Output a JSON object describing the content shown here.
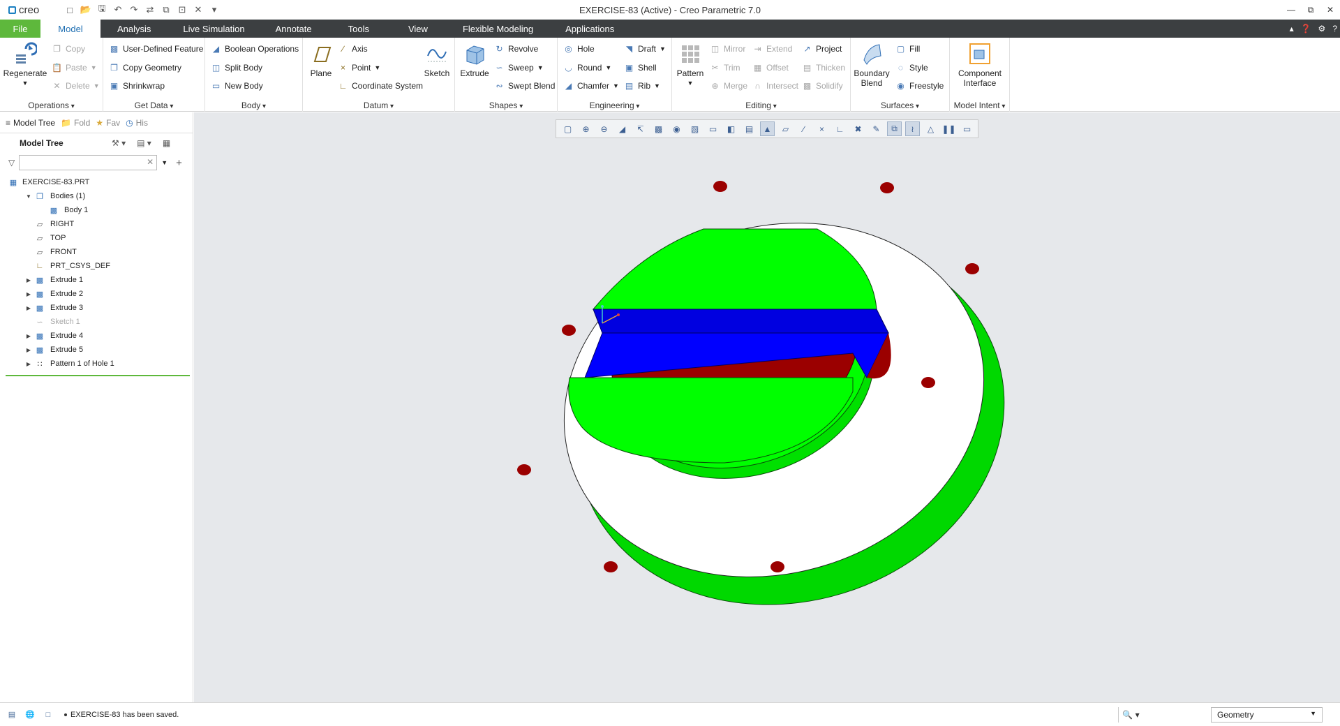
{
  "window": {
    "title": "EXERCISE-83 (Active) - Creo Parametric 7.0",
    "logo": "creo"
  },
  "menu": {
    "tabs": [
      "File",
      "Model",
      "Analysis",
      "Live Simulation",
      "Annotate",
      "Tools",
      "View",
      "Flexible Modeling",
      "Applications"
    ],
    "active": "Model"
  },
  "ribbon": {
    "operations": {
      "label": "Operations",
      "regenerate": "Regenerate",
      "copy": "Copy",
      "paste": "Paste",
      "delete": "Delete"
    },
    "get_data": {
      "label": "Get Data",
      "udf": "User-Defined Feature",
      "copy_geometry": "Copy Geometry",
      "shrinkwrap": "Shrinkwrap"
    },
    "body": {
      "label": "Body",
      "boolean": "Boolean Operations",
      "split": "Split Body",
      "new": "New Body"
    },
    "datum": {
      "label": "Datum",
      "plane": "Plane",
      "axis": "Axis",
      "point": "Point",
      "csys": "Coordinate System",
      "sketch": "Sketch"
    },
    "shapes": {
      "label": "Shapes",
      "extrude": "Extrude",
      "revolve": "Revolve",
      "sweep": "Sweep",
      "swept_blend": "Swept Blend"
    },
    "engineering": {
      "label": "Engineering",
      "hole": "Hole",
      "round": "Round",
      "chamfer": "Chamfer",
      "draft": "Draft",
      "shell": "Shell",
      "rib": "Rib"
    },
    "editing": {
      "label": "Editing",
      "pattern": "Pattern",
      "mirror": "Mirror",
      "trim": "Trim",
      "merge": "Merge",
      "extend": "Extend",
      "offset": "Offset",
      "intersect": "Intersect",
      "project": "Project",
      "thicken": "Thicken",
      "solidify": "Solidify"
    },
    "surfaces": {
      "label": "Surfaces",
      "boundary_blend_1": "Boundary",
      "boundary_blend_2": "Blend",
      "fill": "Fill",
      "style": "Style",
      "freestyle": "Freestyle"
    },
    "model_intent": {
      "label": "Model Intent",
      "component_1": "Component",
      "component_2": "Interface"
    }
  },
  "navigator": {
    "tabs": [
      "Model Tree",
      "Fold",
      "Fav",
      "His"
    ],
    "header": "Model Tree",
    "filter_placeholder": "",
    "tree": [
      {
        "label": "EXERCISE-83.PRT",
        "level": 0,
        "icon": "part-icon",
        "twisty": ""
      },
      {
        "label": "Bodies (1)",
        "level": 1,
        "icon": "bodies-icon",
        "twisty": "open"
      },
      {
        "label": "Body 1",
        "level": 2,
        "icon": "body-icon",
        "twisty": ""
      },
      {
        "label": "RIGHT",
        "level": 1,
        "icon": "datum-plane-icon",
        "twisty": ""
      },
      {
        "label": "TOP",
        "level": 1,
        "icon": "datum-plane-icon",
        "twisty": ""
      },
      {
        "label": "FRONT",
        "level": 1,
        "icon": "datum-plane-icon",
        "twisty": ""
      },
      {
        "label": "PRT_CSYS_DEF",
        "level": 1,
        "icon": "csys-icon",
        "twisty": ""
      },
      {
        "label": "Extrude 1",
        "level": 1,
        "icon": "extrude-icon",
        "twisty": "closed"
      },
      {
        "label": "Extrude 2",
        "level": 1,
        "icon": "extrude-icon",
        "twisty": "closed"
      },
      {
        "label": "Extrude 3",
        "level": 1,
        "icon": "extrude-icon",
        "twisty": "closed"
      },
      {
        "label": "Sketch 1",
        "level": 1,
        "icon": "sketch-icon",
        "twisty": "",
        "dim": true
      },
      {
        "label": "Extrude 4",
        "level": 1,
        "icon": "extrude-icon",
        "twisty": "closed"
      },
      {
        "label": "Extrude 5",
        "level": 1,
        "icon": "extrude-icon",
        "twisty": "closed"
      },
      {
        "label": "Pattern 1 of Hole 1",
        "level": 1,
        "icon": "pattern-icon",
        "twisty": "closed"
      }
    ]
  },
  "status": {
    "message": "EXERCISE-83 has been saved.",
    "selection_filter": "Geometry"
  },
  "colors": {
    "file_tab": "#5eb83c",
    "menu_bg": "#3c3f41",
    "model_green": "#00ff00",
    "model_blue": "#0000ff",
    "model_red": "#9b0000",
    "model_white": "#ffffff"
  }
}
